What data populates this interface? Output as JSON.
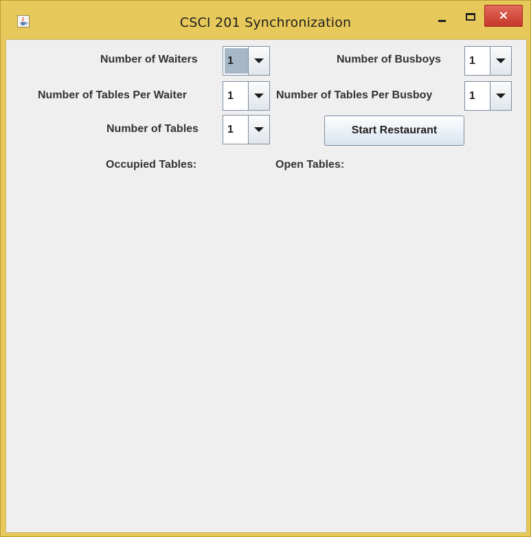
{
  "window": {
    "title": "CSCI 201 Synchronization",
    "close_glyph": "×"
  },
  "form": {
    "waiters_label": "Number of Waiters",
    "waiters_value": "1",
    "busboys_label": "Number of Busboys",
    "busboys_value": "1",
    "tables_per_waiter_label": "Number of Tables Per Waiter",
    "tables_per_waiter_value": "1",
    "tables_per_busboy_label": "Number of Tables Per Busboy",
    "tables_per_busboy_value": "1",
    "tables_label": "Number of Tables",
    "tables_value": "1",
    "start_button_label": "Start Restaurant",
    "occupied_label": "Occupied Tables:",
    "open_label": "Open Tables:"
  },
  "icons": {
    "app": "java-cup-icon",
    "minimize": "minimize-icon",
    "maximize": "maximize-icon",
    "close": "close-icon",
    "dropdown": "chevron-down-icon"
  },
  "colors": {
    "titlebar": "#e7c85a",
    "close_button": "#c7372a",
    "content_bg": "#efefef",
    "combo_selection": "#a6b8c8"
  }
}
